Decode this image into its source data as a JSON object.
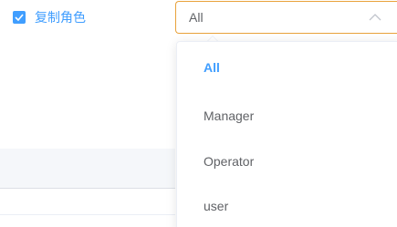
{
  "copy_role": {
    "label": "复制角色",
    "checked": true,
    "icon": "check-icon"
  },
  "role_select": {
    "value": "All",
    "arrow_icon": "chevron-up-icon",
    "options": [
      {
        "label": "All",
        "selected": true
      },
      {
        "label": "Manager",
        "selected": false
      },
      {
        "label": "Operator",
        "selected": false
      },
      {
        "label": "user",
        "selected": false
      }
    ]
  },
  "colors": {
    "primary": "#409eff",
    "focus_border": "#e9a23b",
    "text": "#606266"
  }
}
